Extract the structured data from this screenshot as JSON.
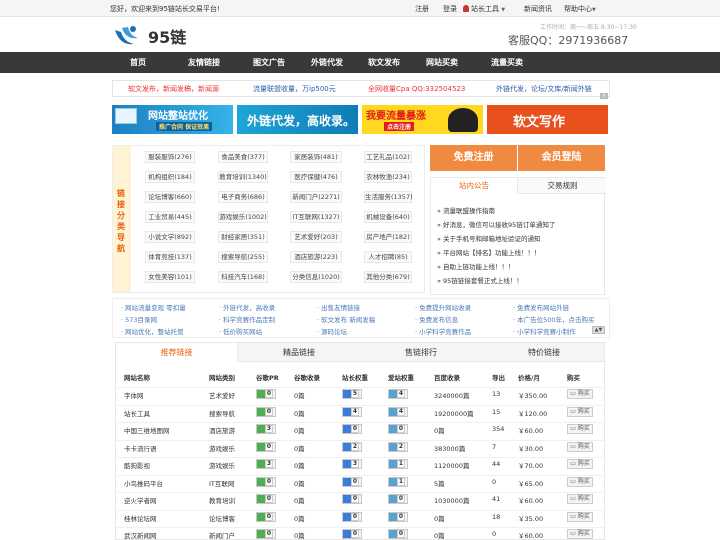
{
  "topbar": {
    "welcome": "您好，欢迎来到95链站长交易平台!",
    "register": "注册",
    "login": "登录",
    "tools": "站长工具",
    "news": "新闻资讯",
    "help": "帮助中心"
  },
  "header": {
    "logo_text": "95链",
    "worktime": "工作时间：周一~周五 8:30~17:30",
    "qq": "客服QQ：2971936687"
  },
  "nav": [
    "首页",
    "友情链接",
    "图文广告",
    "外链代发",
    "软文发布",
    "网站买卖",
    "流量买卖"
  ],
  "notice": {
    "a": "软文发布，新闻发稿，新闻源",
    "b": "流量联盟收量，万ip500元",
    "c": "全网收量Cpa QQ:332504523",
    "d": "外链代发，论坛/文库/新闻外链"
  },
  "banners": {
    "b1_title": "网站整站优化",
    "b1_sub": "推广合同 保证效果",
    "b2": "外链代发，高收录。",
    "b3_title": "我要流量暴涨",
    "b3_sub": "点击注册",
    "b4": "软文写作"
  },
  "category": {
    "side": "链接分类导航",
    "chips": [
      "服装服饰(276)",
      "食品美食(377)",
      "家居装饰(481)",
      "工艺礼品(102)",
      "机构组织(184)",
      "教育培训(1340)",
      "医疗保健(476)",
      "农林牧渔(234)",
      "论坛博客(660)",
      "电子商务(686)",
      "新闻门户(2271)",
      "生活服务(1357)",
      "工业贸易(445)",
      "游戏娱乐(1002)",
      "IT互联网(1327)",
      "机械设备(640)",
      "小说文学(892)",
      "财经家居(351)",
      "艺术爱好(203)",
      "房产地产(182)",
      "体育竞技(137)",
      "搜索导航(255)",
      "酒店旅游(223)",
      "人才招聘(85)",
      "女性美容(101)",
      "科技汽车(168)",
      "分类信息(1020)",
      "其他分类(679)"
    ]
  },
  "auth": {
    "register": "免费注册",
    "login": "会员登陆"
  },
  "announce": {
    "tab1": "站内公告",
    "tab2": "交易规则",
    "items": [
      "流量联盟操作指南",
      "好消息，微信可以接收95链订单通知了",
      "关于手机号和邮箱地址验证的通知",
      "平台网站【排名】功能上线！！！",
      "自助上链功能上线！！！",
      "95链链接套餐正式上线！！"
    ]
  },
  "links": [
    "网站流量变现 零扣量",
    "外链代发，高收录",
    "出售友情链接",
    "免费提升网站收录",
    "免费发布网站外链",
    "573目录网",
    "科学竞赛作品定制",
    "软文发布 新闻发稿",
    "免费发布信息",
    "本广告位500年，点击购买",
    "网站优化，整站托管",
    "低价购买网站",
    "源码论坛",
    "小学科学竞赛作品",
    "小学科学竞赛小制作"
  ],
  "table": {
    "tabs": [
      "推荐链接",
      "精品链接",
      "售链排行",
      "特价链接"
    ],
    "headers": [
      "网站名称",
      "网站类别",
      "谷歌PR",
      "谷歌收录",
      "站长权重",
      "爱站权重",
      "百度收录",
      "导出",
      "价格/月",
      "购买"
    ],
    "buy_label": "购买",
    "rows": [
      {
        "name": "字体网",
        "cat": "艺术爱好",
        "pr": "0",
        "gi": "0篇",
        "w": "5",
        "aw": "4",
        "bi": "3240000篇",
        "out": "13",
        "price": "￥350.00"
      },
      {
        "name": "站长工具",
        "cat": "搜索导航",
        "pr": "0",
        "gi": "0篇",
        "w": "4",
        "aw": "4",
        "bi": "19200000篇",
        "out": "15",
        "price": "￥120.00"
      },
      {
        "name": "中国三维地图网",
        "cat": "酒店旅游",
        "pr": "3",
        "gi": "0篇",
        "w": "0",
        "aw": "0",
        "bi": "0篇",
        "out": "354",
        "price": "￥60.00"
      },
      {
        "name": "卡卡流行语",
        "cat": "游戏娱乐",
        "pr": "0",
        "gi": "0篇",
        "w": "2",
        "aw": "2",
        "bi": "383000篇",
        "out": "7",
        "price": "￥30.00"
      },
      {
        "name": "酷狗影视",
        "cat": "游戏娱乐",
        "pr": "3",
        "gi": "0篇",
        "w": "3",
        "aw": "1",
        "bi": "1120000篇",
        "out": "44",
        "price": "￥70.00"
      },
      {
        "name": "小鸟推码平台",
        "cat": "IT互联网",
        "pr": "0",
        "gi": "0篇",
        "w": "0",
        "aw": "1",
        "bi": "5篇",
        "out": "0",
        "price": "￥65.00"
      },
      {
        "name": "逆火学者网",
        "cat": "教育培训",
        "pr": "0",
        "gi": "0篇",
        "w": "0",
        "aw": "0",
        "bi": "1030000篇",
        "out": "41",
        "price": "￥60.00"
      },
      {
        "name": "桂林论坛网",
        "cat": "论坛博客",
        "pr": "0",
        "gi": "0篇",
        "w": "0",
        "aw": "0",
        "bi": "0篇",
        "out": "18",
        "price": "￥35.00"
      },
      {
        "name": "武汉新闻网",
        "cat": "新闻门户",
        "pr": "0",
        "gi": "0篇",
        "w": "0",
        "aw": "0",
        "bi": "0篇",
        "out": "0",
        "price": "￥60.00"
      }
    ]
  }
}
